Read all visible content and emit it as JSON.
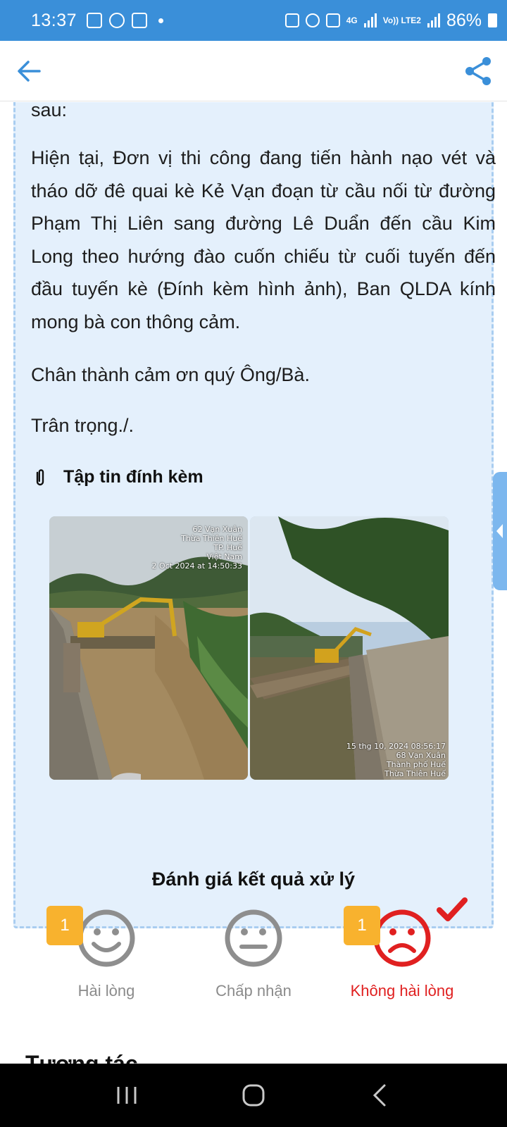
{
  "status_bar": {
    "time": "13:37",
    "network_top": "4G",
    "volte_label": "Vo)) LTE2",
    "battery": "86%"
  },
  "header": {
    "back_icon": "arrow-left-icon",
    "share_icon": "share-icon",
    "accent_color": "#3a8fd9"
  },
  "response": {
    "cut_off_line": "..... (.....) ..... ..... ..... ..... .....",
    "p1": "sau:",
    "p2": "Hiện tại, Đơn vị thi công đang tiến hành nạo vét và tháo dỡ đê quai kè Kẻ Vạn đoạn từ cầu nối từ đường Phạm Thị Liên sang đường Lê Duẩn đến cầu Kim Long theo hướng đào cuốn chiếu từ cuối tuyến đến đầu tuyến kè (Đính kèm hình ảnh), Ban QLDA kính mong bà con thông cảm.",
    "p3": "Chân thành cảm ơn quý Ông/Bà.",
    "p4": "Trân trọng./.",
    "attachments_title": "Tập tin đính kèm",
    "photos": [
      {
        "stamp_lines": [
          "62 Vạn Xuân",
          "Thừa Thiên Huế",
          "TP. Huế",
          "Việt Nam",
          "2 Oct 2024 at 14:50:33"
        ]
      },
      {
        "stamp_lines": [
          "15 thg 10, 2024 08:56:17",
          "68 Vạn Xuân",
          "Thành phố Huế",
          "Thừa Thiên Huế"
        ]
      }
    ]
  },
  "rating": {
    "title": "Đánh giá kết quả xử lý",
    "options": [
      {
        "label": "Hài lòng",
        "count": "1",
        "icon": "smile-face-icon",
        "selected": false
      },
      {
        "label": "Chấp nhận",
        "count": "",
        "icon": "neutral-face-icon",
        "selected": false
      },
      {
        "label": "Không hài lòng",
        "count": "1",
        "icon": "sad-face-icon",
        "selected": true
      }
    ],
    "badge_color": "#f8b22e",
    "selected_color": "#e02020"
  },
  "next_section_title": "Tương tác"
}
